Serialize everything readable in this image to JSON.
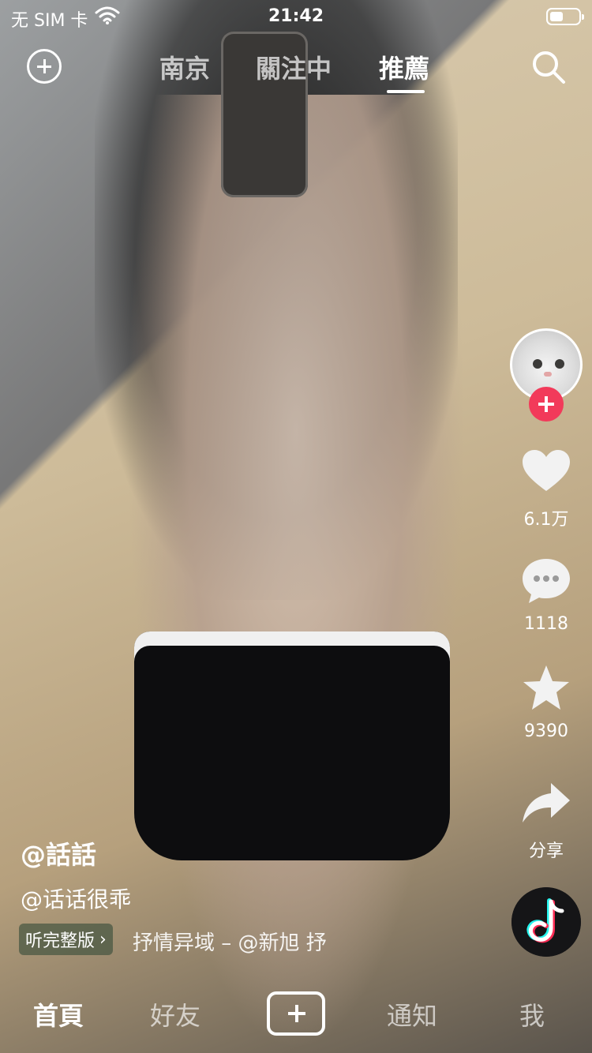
{
  "status_bar": {
    "carrier": "无 SIM 卡",
    "time": "21:42"
  },
  "top_tabs": [
    {
      "label": "南京",
      "active": false
    },
    {
      "label": "關注中",
      "active": false
    },
    {
      "label": "推薦",
      "active": true
    }
  ],
  "rail": {
    "likes": "6.1万",
    "comments": "1118",
    "favorites": "9390",
    "share": "分享"
  },
  "caption": {
    "author": "@話話",
    "handle": "@话话很乖",
    "music_pill": "听完整版",
    "music_text": "抒情异域 – @新旭   抒"
  },
  "bottom_nav": [
    {
      "label": "首頁",
      "active": true
    },
    {
      "label": "好友",
      "active": false
    },
    {
      "label": "通知",
      "active": false
    },
    {
      "label": "我",
      "active": false
    }
  ],
  "colors": {
    "accent_red": "#f23a5a",
    "text": "#ffffff"
  }
}
